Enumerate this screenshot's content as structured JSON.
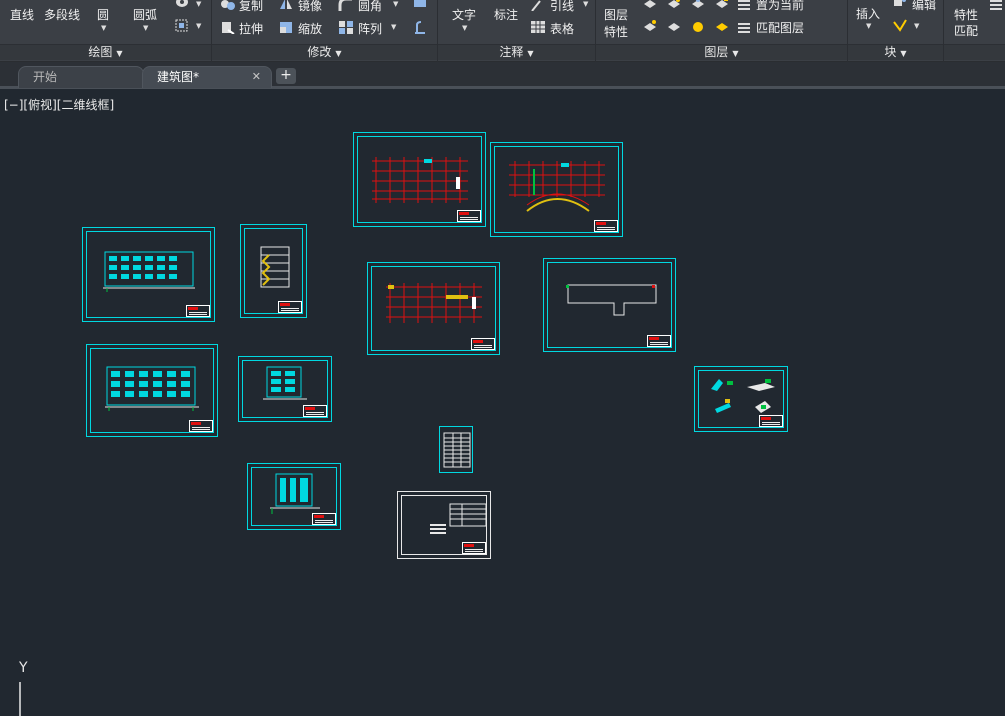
{
  "ribbon": {
    "draw": {
      "line": "直线",
      "polyline": "多段线",
      "circle": "圆",
      "arc": "圆弧",
      "title": "绘图"
    },
    "modify": {
      "copy": "复制",
      "mirror": "镜像",
      "fillet": "圆角",
      "stretch": "拉伸",
      "scale": "缩放",
      "array": "阵列",
      "title": "修改"
    },
    "annotation": {
      "text": "文字",
      "dimension": "标注",
      "leader": "引线",
      "table": "表格",
      "title": "注释"
    },
    "layers": {
      "properties_line1": "图层",
      "properties_line2": "特性",
      "set_current": "置为当前",
      "match_layer": "匹配图层",
      "title": "图层"
    },
    "block": {
      "insert": "插入",
      "edit": "编辑",
      "title": "块"
    },
    "properties": {
      "match_line1": "特性",
      "match_line2": "匹配"
    }
  },
  "tabs": [
    {
      "label": "开始",
      "active": false
    },
    {
      "label": "建筑图*",
      "active": true
    }
  ],
  "viewport": {
    "label": "[−][俯视][二维线框]",
    "ucs_y_label": "Y"
  },
  "sheets": [
    {
      "name": "floor-plan-1",
      "kind": "grid-plan"
    },
    {
      "name": "floor-plan-2",
      "kind": "curved-plan"
    },
    {
      "name": "elevation-1",
      "kind": "elevation"
    },
    {
      "name": "section-1",
      "kind": "section"
    },
    {
      "name": "floor-plan-3",
      "kind": "grid-plan"
    },
    {
      "name": "site-outline",
      "kind": "outline"
    },
    {
      "name": "elevation-2",
      "kind": "elevation"
    },
    {
      "name": "elevation-3",
      "kind": "elevation-small"
    },
    {
      "name": "details",
      "kind": "details"
    },
    {
      "name": "door-window-table",
      "kind": "table"
    },
    {
      "name": "elevation-4",
      "kind": "elevation-small"
    },
    {
      "name": "cover-notes",
      "kind": "notes"
    }
  ],
  "colors": {
    "accent": "#00d8e0",
    "grid": "#e01010",
    "background": "#212830"
  }
}
